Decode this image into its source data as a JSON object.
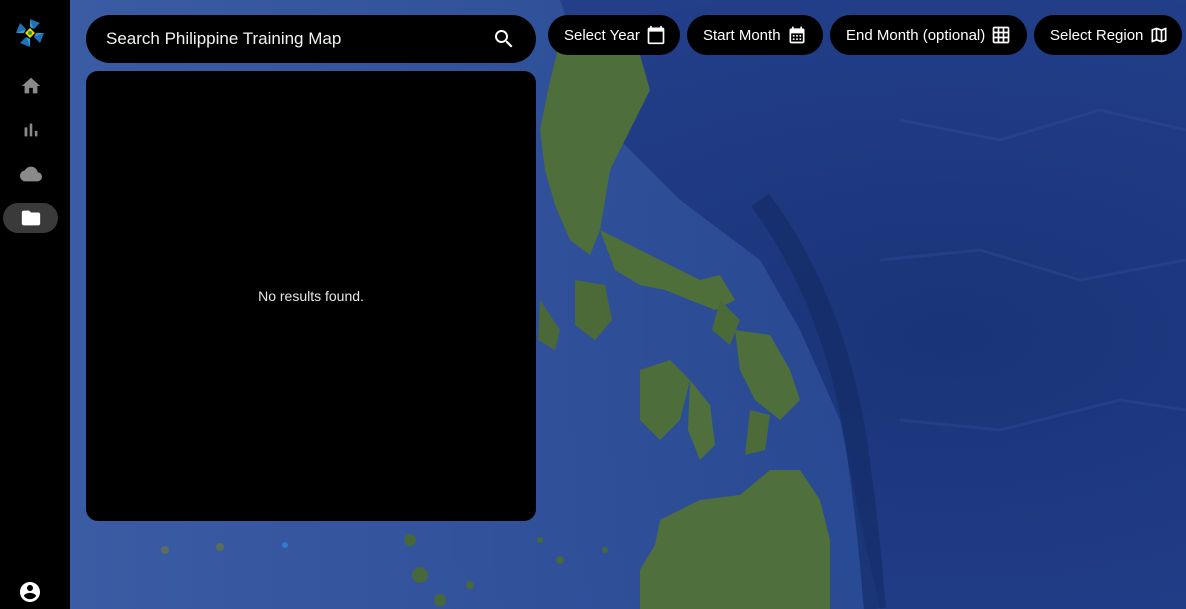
{
  "search": {
    "placeholder": "Search Philippine Training Map"
  },
  "results": {
    "empty_message": "No results found."
  },
  "filters": [
    {
      "label": "Select Year",
      "icon": "calendar-icon"
    },
    {
      "label": "Start Month",
      "icon": "calendar-month-icon"
    },
    {
      "label": "End Month (optional)",
      "icon": "grid-icon"
    },
    {
      "label": "Select Region",
      "icon": "map-icon"
    }
  ],
  "sidebar": {
    "items": [
      {
        "name": "home",
        "icon": "home-icon"
      },
      {
        "name": "statistics",
        "icon": "bar-chart-icon"
      },
      {
        "name": "cloud",
        "icon": "cloud-icon"
      },
      {
        "name": "folder",
        "icon": "folder-icon",
        "active": true
      }
    ],
    "account_icon": "account-circle-icon"
  },
  "colors": {
    "panel": "#000000",
    "ocean": "#1f3f86",
    "land": "#4f6e3c",
    "text": "#ffffff"
  }
}
